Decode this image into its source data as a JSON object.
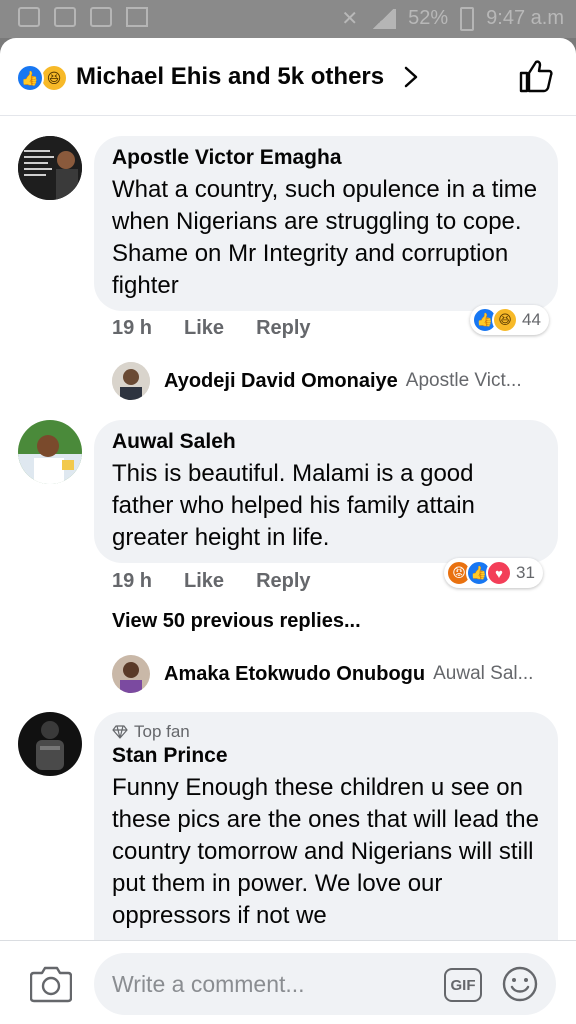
{
  "status_bar": {
    "battery": "52%",
    "time": "9:47 a.m"
  },
  "header": {
    "title": "Michael Ehis and 5k others",
    "reaction_icons": [
      "like-icon",
      "haha-icon"
    ]
  },
  "comments": [
    {
      "author": "Apostle Victor Emagha",
      "text": "What a country, such opulence in a time when Nigerians are struggling to cope. Shame on Mr Integrity and corruption fighter",
      "time": "19 h",
      "like_label": "Like",
      "reply_label": "Reply",
      "reaction_count": "44",
      "reaction_icons": [
        "like-icon",
        "haha-icon"
      ],
      "reply": {
        "author": "Ayodeji David Omonaiye",
        "preview": "Apostle Vict..."
      }
    },
    {
      "author": "Auwal Saleh",
      "text": "This is beautiful. Malami is a good father who helped his family attain greater height in life.",
      "time": "19 h",
      "like_label": "Like",
      "reply_label": "Reply",
      "reaction_count": "31",
      "reaction_icons": [
        "angry-icon",
        "like-icon",
        "love-icon"
      ],
      "view_previous": "View 50 previous replies...",
      "reply": {
        "author": "Amaka Etokwudo Onubogu",
        "preview": "Auwal Sal..."
      }
    },
    {
      "badge": "Top fan",
      "author": "Stan Prince",
      "text": "Funny Enough these children u see on these pics  are the ones that will lead the country tomorrow and Nigerians will still put them in power. We love our oppressors if not we"
    }
  ],
  "composer": {
    "placeholder": "Write a comment...",
    "gif_label": "GIF"
  },
  "colors": {
    "accent": "#1877f2",
    "bubble": "#f0f2f5",
    "meta_text": "#65676b"
  }
}
